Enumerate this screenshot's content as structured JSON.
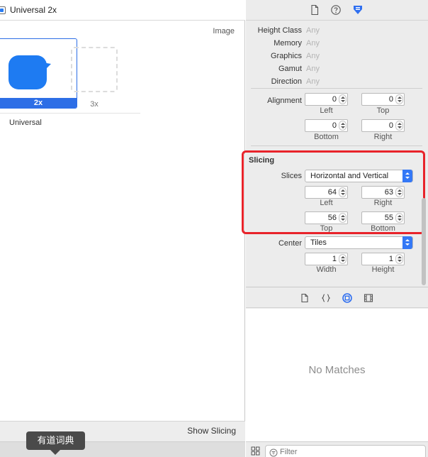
{
  "editor": {
    "header_title": "Universal 2x",
    "image_label": "Image",
    "slots": [
      {
        "label": "2x",
        "filled": true,
        "selected": true
      },
      {
        "label": "3x",
        "filled": false,
        "selected": false
      }
    ],
    "group_label": "Universal",
    "show_slicing_label": "Show Slicing",
    "tooltip_text": "有道词典"
  },
  "inspector": {
    "tabs": [
      {
        "icon": "file-icon",
        "active": false
      },
      {
        "icon": "help-icon",
        "active": false
      },
      {
        "icon": "attributes-icon",
        "active": true
      }
    ],
    "traits": [
      {
        "label": "Height Class",
        "value": "Any"
      },
      {
        "label": "Memory",
        "value": "Any"
      },
      {
        "label": "Graphics",
        "value": "Any"
      },
      {
        "label": "Gamut",
        "value": "Any"
      },
      {
        "label": "Direction",
        "value": "Any"
      }
    ],
    "alignment": {
      "label": "Alignment",
      "left": "0",
      "top": "0",
      "bottom": "0",
      "right": "0",
      "left_label": "Left",
      "top_label": "Top",
      "bottom_label": "Bottom",
      "right_label": "Right"
    },
    "slicing": {
      "title": "Slicing",
      "slices_label": "Slices",
      "slices_value": "Horizontal and Vertical",
      "left": "64",
      "right": "63",
      "top": "56",
      "bottom": "55",
      "left_label": "Left",
      "right_label": "Right",
      "top_label": "Top",
      "bottom_label": "Bottom"
    },
    "center": {
      "label": "Center",
      "value": "Tiles",
      "width": "1",
      "height": "1",
      "width_label": "Width",
      "height_label": "Height"
    }
  },
  "library": {
    "tabs": [
      "file-template-icon",
      "code-snippet-icon",
      "object-icon",
      "media-icon"
    ],
    "active_tab": "object-icon",
    "empty_text": "No Matches",
    "filter_placeholder": "Filter"
  },
  "colors": {
    "accent": "#3478f6",
    "highlight_box": "#e8232a",
    "bubble": "#1e7bf2"
  }
}
